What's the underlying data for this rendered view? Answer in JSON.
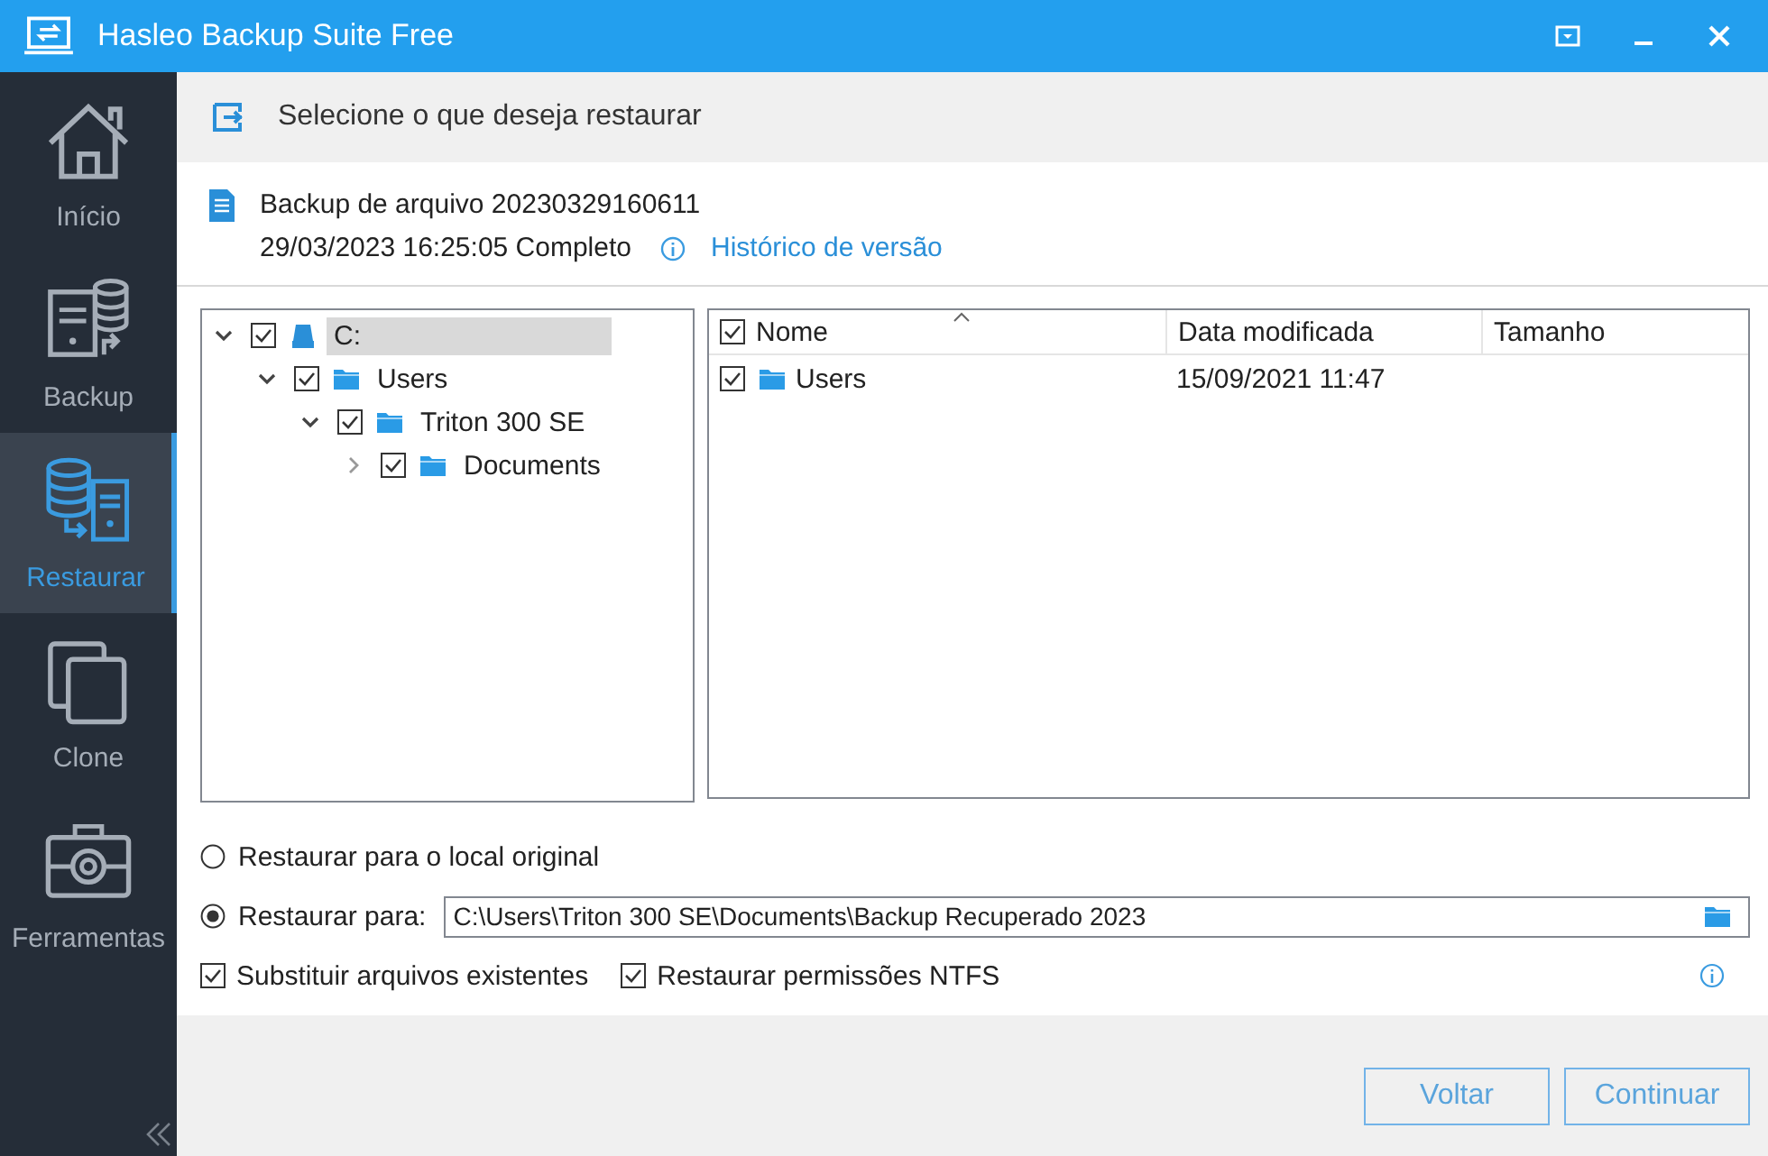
{
  "window": {
    "title": "Hasleo Backup Suite Free"
  },
  "sidebar": {
    "items": [
      {
        "label": "Início",
        "kind": "home",
        "selected": false
      },
      {
        "label": "Backup",
        "kind": "backup",
        "selected": false
      },
      {
        "label": "Restaurar",
        "kind": "restore",
        "selected": true
      },
      {
        "label": "Clone",
        "kind": "clone",
        "selected": false
      },
      {
        "label": "Ferramentas",
        "kind": "tools",
        "selected": false
      }
    ]
  },
  "header": {
    "title": "Selecione o que deseja restaurar"
  },
  "backup": {
    "name": "Backup de arquivo 20230329160611",
    "details": "29/03/2023 16:25:05 Completo",
    "link": "Histórico de versão"
  },
  "tree": [
    {
      "label": "C:",
      "kind": "drive",
      "checked": true,
      "expanded": true,
      "selected": true,
      "children": [
        {
          "label": "Users",
          "kind": "folder",
          "checked": true,
          "expanded": true,
          "selected": false,
          "children": [
            {
              "label": "Triton 300 SE",
              "kind": "folder",
              "checked": true,
              "expanded": true,
              "selected": false,
              "children": [
                {
                  "label": "Documents",
                  "kind": "folder",
                  "checked": true,
                  "expanded": false,
                  "selected": false
                }
              ]
            }
          ]
        }
      ]
    }
  ],
  "list": {
    "all_checked": true,
    "columns": [
      "Nome",
      "Data modificada",
      "Tamanho"
    ],
    "rows": [
      {
        "name": "Users",
        "date": "15/09/2021 11:47",
        "checked": true
      }
    ]
  },
  "options": {
    "radios": [
      {
        "label": "Restaurar para o local original",
        "selected": false
      },
      {
        "label": "Restaurar para:",
        "selected": true
      }
    ],
    "path": "C:\\Users\\Triton 300 SE\\Documents\\Backup Recuperado 2023",
    "checkboxes": [
      {
        "label": "Substituir arquivos existentes",
        "checked": true
      },
      {
        "label": "Restaurar permissões NTFS",
        "checked": true
      }
    ]
  },
  "buttons": [
    "Voltar",
    "Continuar"
  ]
}
